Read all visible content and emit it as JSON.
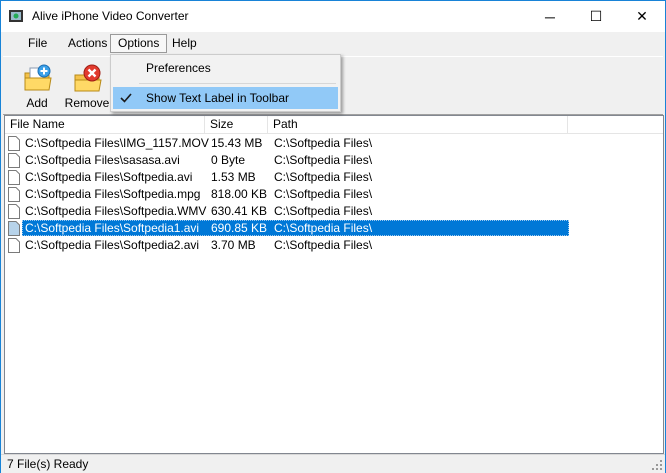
{
  "window": {
    "title": "Alive iPhone Video Converter",
    "minimize_glyph": "─",
    "maximize_glyph": "☐",
    "close_glyph": "✕"
  },
  "menu": [
    "File",
    "Actions",
    "Options",
    "Help"
  ],
  "toolbar": {
    "add_label": "Add",
    "remove_label": "Remove"
  },
  "options_menu": {
    "items": [
      {
        "label": "Preferences",
        "checked": false
      },
      {
        "label": "Show Text Label in Toolbar",
        "checked": true
      }
    ]
  },
  "file_list": {
    "columns": [
      "File Name",
      "Size",
      "Path"
    ],
    "rows": [
      {
        "name": "C:\\Softpedia Files\\IMG_1157.MOV",
        "size": "15.43 MB",
        "path": "C:\\Softpedia Files\\",
        "selected": false
      },
      {
        "name": "C:\\Softpedia Files\\sasasa.avi",
        "size": "0 Byte",
        "path": "C:\\Softpedia Files\\",
        "selected": false
      },
      {
        "name": "C:\\Softpedia Files\\Softpedia.avi",
        "size": "1.53 MB",
        "path": "C:\\Softpedia Files\\",
        "selected": false
      },
      {
        "name": "C:\\Softpedia Files\\Softpedia.mpg",
        "size": "818.00 KB",
        "path": "C:\\Softpedia Files\\",
        "selected": false
      },
      {
        "name": "C:\\Softpedia Files\\Softpedia.WMV",
        "size": "630.41 KB",
        "path": "C:\\Softpedia Files\\",
        "selected": false
      },
      {
        "name": "C:\\Softpedia Files\\Softpedia1.avi",
        "size": "690.85 KB",
        "path": "C:\\Softpedia Files\\",
        "selected": true
      },
      {
        "name": "C:\\Softpedia Files\\Softpedia2.avi",
        "size": "3.70 MB",
        "path": "C:\\Softpedia Files\\",
        "selected": false
      }
    ]
  },
  "status": "7 File(s) Ready",
  "colors": {
    "selection": "#0078d7",
    "menu_highlight": "#91c9f7",
    "window_border": "#1883d7"
  }
}
